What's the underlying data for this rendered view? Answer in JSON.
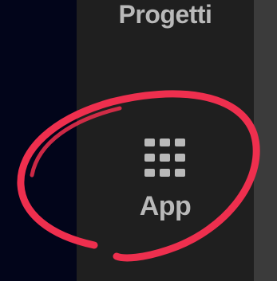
{
  "sidebar": {
    "items": [
      {
        "label": "Progetti",
        "icon": "folder-icon"
      },
      {
        "label": "App",
        "icon": "apps-grid-icon"
      }
    ]
  },
  "annotation": {
    "type": "hand-drawn-circle",
    "color": "#ee2f4e"
  },
  "colors": {
    "background": "#02051a",
    "sidebar": "#1f1f1f",
    "content_edge": "#3b3b3b",
    "label": "#b9b9b9"
  }
}
